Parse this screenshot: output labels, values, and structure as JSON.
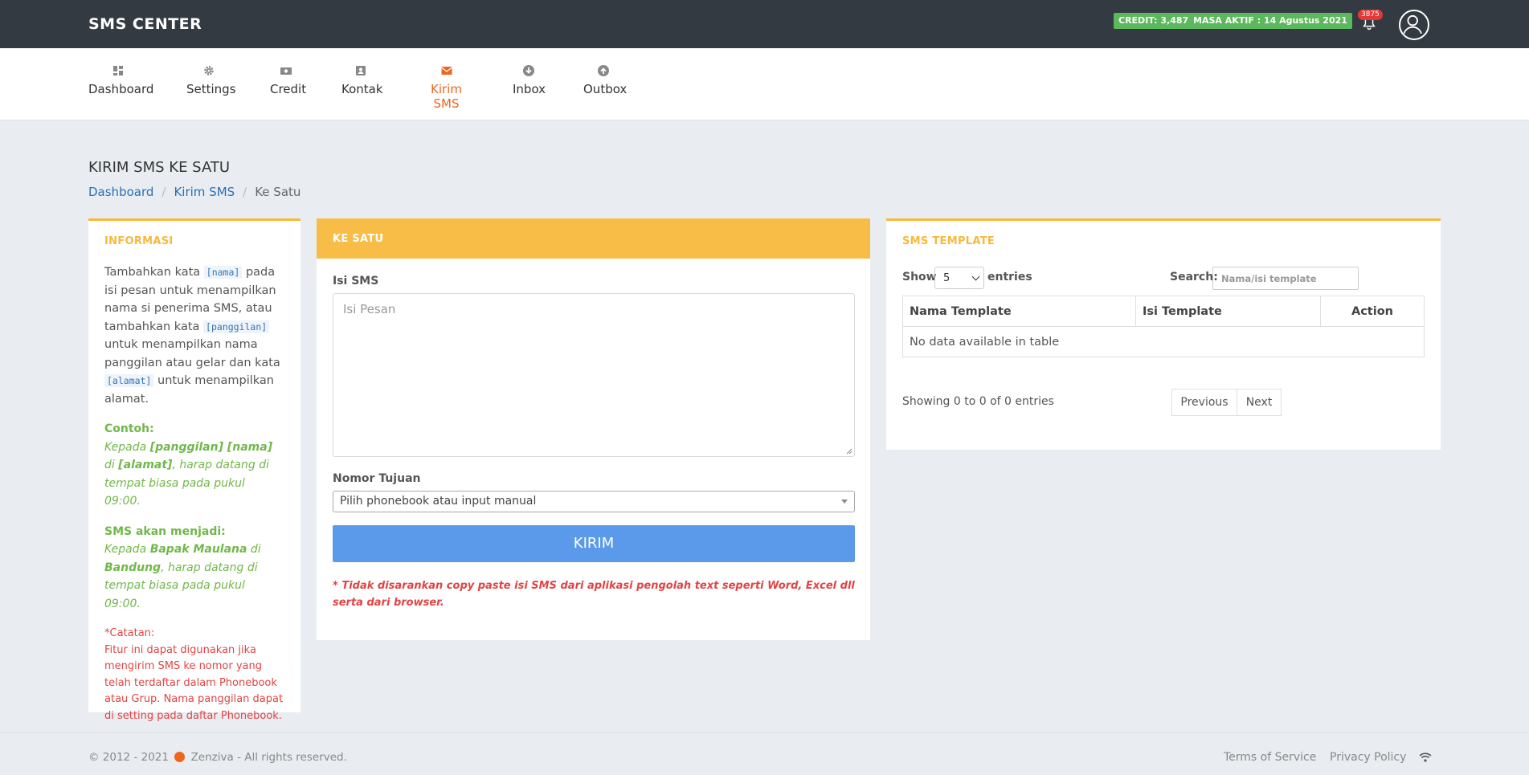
{
  "app": {
    "title": "SMS CENTER"
  },
  "header": {
    "credit": "CREDIT: 3,487",
    "masa_aktif": "MASA AKTIF : 14 Agustus 2021",
    "notif_count": "3875"
  },
  "nav": {
    "items": [
      {
        "label": "Dashboard",
        "icon": "dashboard-icon"
      },
      {
        "label": "Settings",
        "icon": "gear-icon"
      },
      {
        "label": "Credit",
        "icon": "money-icon"
      },
      {
        "label": "Kontak",
        "icon": "contact-card-icon"
      },
      {
        "label": "Kirim SMS",
        "icon": "envelope-icon",
        "active": true
      },
      {
        "label": "Inbox",
        "icon": "arrow-down-circle-icon"
      },
      {
        "label": "Outbox",
        "icon": "arrow-up-circle-icon"
      }
    ]
  },
  "page": {
    "title": "KIRIM SMS KE SATU",
    "breadcrumb": [
      "Dashboard",
      "Kirim SMS",
      "Ke Satu"
    ]
  },
  "info": {
    "title": "INFORMASI",
    "p1": "Tambahkan kata",
    "code_nama": "[nama]",
    "p2": "pada isi pesan untuk menampilkan nama si penerima SMS, atau tambahkan kata",
    "code_panggilan": "[panggilan]",
    "p3": "untuk menampilkan nama panggilan atau gelar dan kata",
    "code_alamat": "[alamat]",
    "p4": "untuk menampilkan alamat.",
    "contoh_label": "Contoh:",
    "contoh_1": "Kepada",
    "contoh_b1": "[panggilan] [nama]",
    "contoh_2": "di",
    "contoh_b2": "[alamat]",
    "contoh_3": ", harap datang di tempat biasa pada pukul 09:00.",
    "hasil_label": "SMS akan menjadi:",
    "hasil_1": "Kepada",
    "hasil_b1": "Bapak Maulana",
    "hasil_2": "di",
    "hasil_b2": "Bandung",
    "hasil_3": ", harap datang di tempat biasa pada pukul 09:00.",
    "catatan_label": "*Catatan:",
    "catatan": "Fitur ini dapat digunakan jika mengirim SMS ke nomor yang telah terdaftar dalam Phonebook atau Grup. Nama panggilan dapat di setting pada daftar Phonebook."
  },
  "form": {
    "title": "KE SATU",
    "isi_label": "Isi SMS",
    "isi_placeholder": "Isi Pesan",
    "nomor_label": "Nomor Tujuan",
    "nomor_value": "Pilih phonebook atau input manual",
    "submit": "KIRIM",
    "warning": "* Tidak disarankan copy paste isi SMS dari aplikasi pengolah text seperti Word, Excel dll serta dari browser."
  },
  "template": {
    "title": "SMS TEMPLATE",
    "show_label": "Show",
    "length_value": "5",
    "entries_label": "entries",
    "search_label": "Search:",
    "search_placeholder": "Nama/isi template",
    "columns": [
      "Nama Template",
      "Isi Template",
      "Action"
    ],
    "empty": "No data available in table",
    "info": "Showing 0 to 0 of 0 entries",
    "prev": "Previous",
    "next": "Next"
  },
  "footer": {
    "copyright": "© 2012 - 2021",
    "brand": "Zenziva - All rights reserved.",
    "terms": "Terms of Service",
    "privacy": "Privacy Policy"
  },
  "colors": {
    "accent": "#f8b93a",
    "active_nav": "#f0641e",
    "button": "#5b9aeb",
    "topbar": "#343a42"
  }
}
